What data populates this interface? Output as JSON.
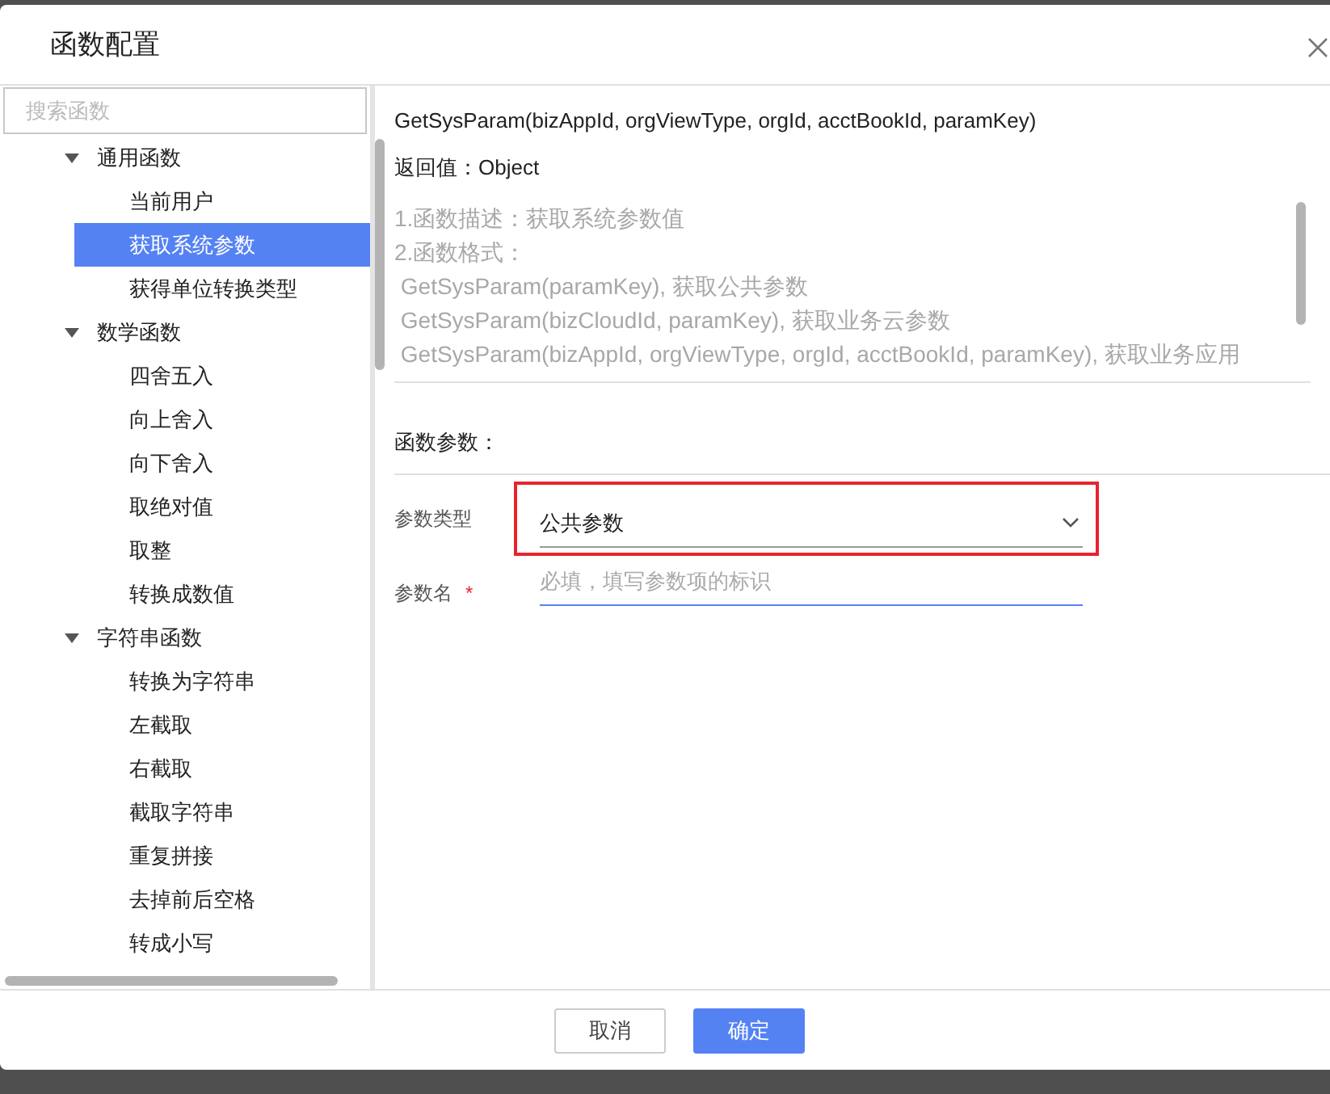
{
  "dialog": {
    "title": "函数配置"
  },
  "sidebar": {
    "search": {
      "placeholder": "搜索函数"
    },
    "tree": [
      {
        "label": "通用函数",
        "expanded": true,
        "children": [
          {
            "label": "当前用户",
            "selected": false
          },
          {
            "label": "获取系统参数",
            "selected": true
          },
          {
            "label": "获得单位转换类型",
            "selected": false
          }
        ]
      },
      {
        "label": "数学函数",
        "expanded": true,
        "children": [
          {
            "label": "四舍五入",
            "selected": false
          },
          {
            "label": "向上舍入",
            "selected": false
          },
          {
            "label": "向下舍入",
            "selected": false
          },
          {
            "label": "取绝对值",
            "selected": false
          },
          {
            "label": "取整",
            "selected": false
          },
          {
            "label": "转换成数值",
            "selected": false
          }
        ]
      },
      {
        "label": "字符串函数",
        "expanded": true,
        "children": [
          {
            "label": "转换为字符串",
            "selected": false
          },
          {
            "label": "左截取",
            "selected": false
          },
          {
            "label": "右截取",
            "selected": false
          },
          {
            "label": "截取字符串",
            "selected": false
          },
          {
            "label": "重复拼接",
            "selected": false
          },
          {
            "label": "去掉前后空格",
            "selected": false
          },
          {
            "label": "转成小写",
            "selected": false
          }
        ]
      }
    ]
  },
  "detail": {
    "signature": "GetSysParam(bizAppId, orgViewType, orgId, acctBookId, paramKey)",
    "return_value": "返回值：Object",
    "description": [
      "1.函数描述：获取系统参数值",
      "2.函数格式：",
      " GetSysParam(paramKey), 获取公共参数",
      " GetSysParam(bizCloudId, paramKey), 获取业务云参数",
      " GetSysParam(bizAppId, orgViewType, orgId, acctBookId, paramKey), 获取业务应用"
    ],
    "params_title": "函数参数：",
    "params": [
      {
        "kind": "select",
        "label": "参数类型",
        "value": "公共参数",
        "highlighted": true
      },
      {
        "kind": "input",
        "label": "参数名",
        "placeholder": "必填，填写参数项的标识",
        "required_mark": "*",
        "highlighted": false
      }
    ]
  },
  "buttons": [
    {
      "label": "取消",
      "primary": false
    },
    {
      "label": "确定",
      "primary": true
    }
  ]
}
